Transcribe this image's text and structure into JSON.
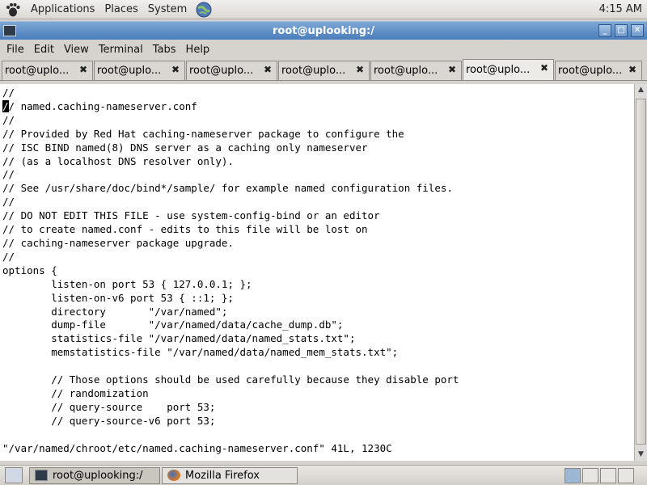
{
  "top_panel": {
    "menus": [
      "Applications",
      "Places",
      "System"
    ],
    "clock": "4:15 AM"
  },
  "window": {
    "title": "root@uplooking:/",
    "menu": [
      "File",
      "Edit",
      "View",
      "Terminal",
      "Tabs",
      "Help"
    ],
    "tabs": [
      {
        "label": "root@uplo...",
        "active": false
      },
      {
        "label": "root@uplo...",
        "active": false
      },
      {
        "label": "root@uplo...",
        "active": false
      },
      {
        "label": "root@uplo...",
        "active": false
      },
      {
        "label": "root@uplo...",
        "active": false
      },
      {
        "label": "root@uplo...",
        "active": true
      },
      {
        "label": "root@uplo...",
        "active": false
      }
    ],
    "tab_close_glyph": "✖"
  },
  "terminal": {
    "lines": [
      "//",
      "// named.caching-nameserver.conf",
      "//",
      "// Provided by Red Hat caching-nameserver package to configure the",
      "// ISC BIND named(8) DNS server as a caching only nameserver",
      "// (as a localhost DNS resolver only).",
      "//",
      "// See /usr/share/doc/bind*/sample/ for example named configuration files.",
      "//",
      "// DO NOT EDIT THIS FILE - use system-config-bind or an editor",
      "// to create named.conf - edits to this file will be lost on",
      "// caching-nameserver package upgrade.",
      "//",
      "options {",
      "        listen-on port 53 { 127.0.0.1; };",
      "        listen-on-v6 port 53 { ::1; };",
      "        directory       \"/var/named\";",
      "        dump-file       \"/var/named/data/cache_dump.db\";",
      "        statistics-file \"/var/named/data/named_stats.txt\";",
      "        memstatistics-file \"/var/named/data/named_mem_stats.txt\";",
      "",
      "        // Those options should be used carefully because they disable port",
      "        // randomization",
      "        // query-source    port 53;",
      "        // query-source-v6 port 53;",
      "",
      "\"/var/named/chroot/etc/named.caching-nameserver.conf\" 41L, 1230C"
    ],
    "cursor_line": 1,
    "cursor_char": "/"
  },
  "bottom_panel": {
    "tasks": [
      {
        "label": "root@uplooking:/",
        "active": true,
        "icon": "terminal-icon"
      },
      {
        "label": "Mozilla Firefox",
        "active": false,
        "icon": "firefox-icon"
      }
    ]
  }
}
